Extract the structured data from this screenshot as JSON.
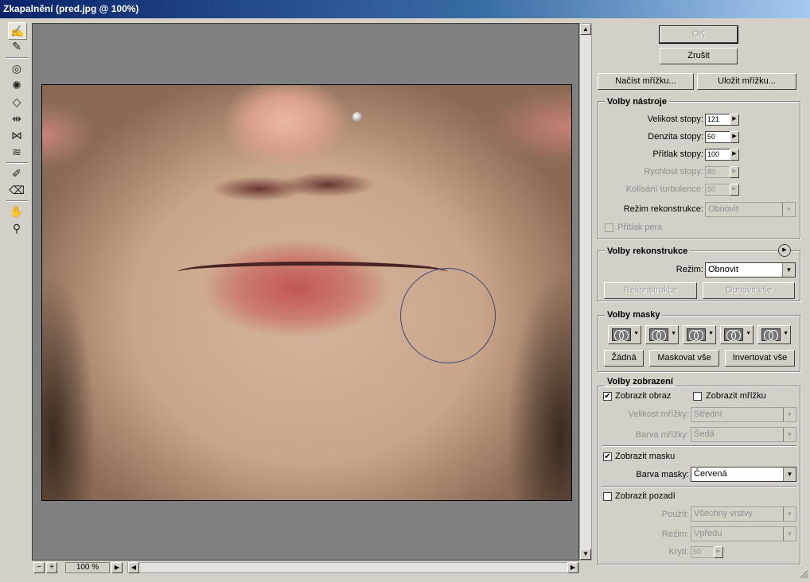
{
  "window": {
    "title": "Zkapalnění (pred.jpg @ 100%)"
  },
  "tools": [
    {
      "name": "warp-tool-icon",
      "glyph": "✍",
      "active": true
    },
    {
      "name": "reconstruct-tool-icon",
      "glyph": "✎"
    },
    {
      "name": "twirl-clockwise-icon",
      "glyph": "◎"
    },
    {
      "name": "pucker-tool-icon",
      "glyph": "✺"
    },
    {
      "name": "bloat-tool-icon",
      "glyph": "◇"
    },
    {
      "name": "push-left-tool-icon",
      "glyph": "⇹"
    },
    {
      "name": "mirror-tool-icon",
      "glyph": "⋈"
    },
    {
      "name": "turbulence-tool-icon",
      "glyph": "≋"
    },
    {
      "name": "freeze-mask-icon",
      "glyph": "✐"
    },
    {
      "name": "thaw-mask-icon",
      "glyph": "⌫"
    },
    {
      "name": "hand-tool-icon",
      "glyph": "✋"
    },
    {
      "name": "zoom-tool-icon",
      "glyph": "⚲"
    }
  ],
  "zoom": {
    "minus": "−",
    "plus": "+",
    "value": "100 %",
    "menu": "▶"
  },
  "buttons": {
    "ok": "OK",
    "cancel": "Zrušit",
    "load_mesh": "Načíst mřížku...",
    "save_mesh": "Uložit mřížku..."
  },
  "tool_options": {
    "title": "Volby nástroje",
    "brush_size_label": "Velikost stopy:",
    "brush_size": "121",
    "brush_density_label": "Denzita stopy:",
    "brush_density": "50",
    "brush_pressure_label": "Přítlak stopy:",
    "brush_pressure": "100",
    "brush_rate_label": "Rychlost stopy:",
    "brush_rate": "80",
    "turbulent_jitter_label": "Kolísání turbulence:",
    "turbulent_jitter": "50",
    "reconstruct_mode_label": "Režim rekonstrukce:",
    "reconstruct_mode": "Obnovit",
    "stylus_pressure_label": "Přítlak pera"
  },
  "reconstruct_options": {
    "title": "Volby rekonstrukce",
    "mode_label": "Režim:",
    "mode": "Obnovit",
    "reconstruct_button": "Rekonstrukce",
    "restore_all_button": "Obnovit vše"
  },
  "mask_options": {
    "title": "Volby masky",
    "none_button": "Žádná",
    "mask_all_button": "Maskovat vše",
    "invert_all_button": "Invertovat vše"
  },
  "view_options": {
    "title": "Volby zobrazení",
    "show_image_label": "Zobrazit obraz",
    "show_image": true,
    "show_mesh_label": "Zobrazit mřížku",
    "show_mesh": false,
    "mesh_size_label": "Velikost mřížky:",
    "mesh_size": "Střední",
    "mesh_color_label": "Barva mřížky:",
    "mesh_color": "Šedá",
    "show_mask_label": "Zobrazit masku",
    "show_mask": true,
    "mask_color_label": "Barva masky:",
    "mask_color": "Červená",
    "show_backdrop_label": "Zobrazit pozadí",
    "show_backdrop": false,
    "use_label": "Použít:",
    "use": "Všechny vrstvy",
    "mode_label": "Režim:",
    "mode": "Vpředu",
    "opacity_label": "Krytí:",
    "opacity": "50"
  },
  "icons": {
    "check": "✔",
    "dropdown": "▼",
    "right": "▶",
    "up": "▲",
    "down": "▼",
    "left": "◀",
    "menu_circle": "▶"
  }
}
